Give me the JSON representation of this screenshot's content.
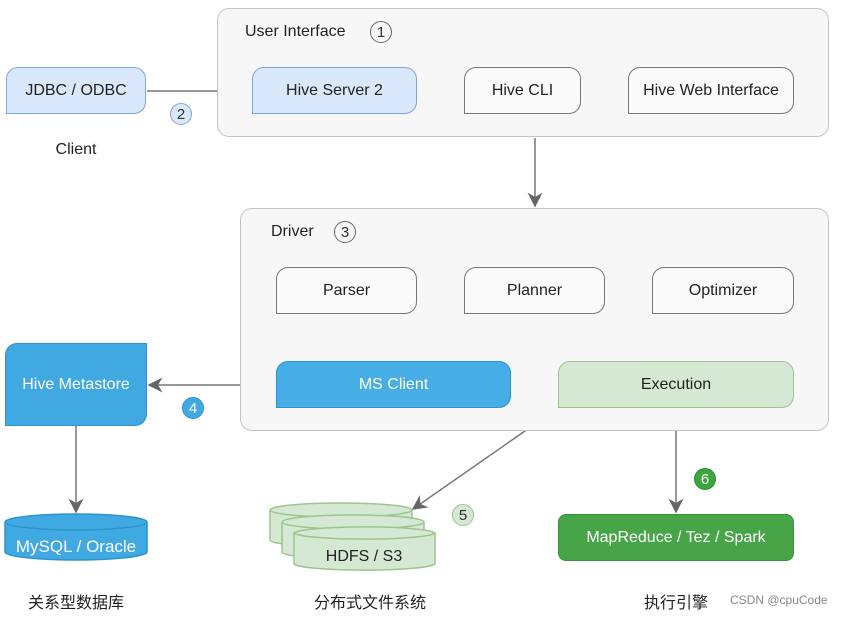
{
  "client": {
    "jdbc": "JDBC / ODBC",
    "label": "Client",
    "step": "2"
  },
  "ui": {
    "title": "User Interface",
    "step": "1",
    "hive_server": "Hive Server 2",
    "hive_cli": "Hive CLI",
    "hive_web": "Hive Web Interface"
  },
  "driver": {
    "title": "Driver",
    "step": "3",
    "parser": "Parser",
    "planner": "Planner",
    "optimizer": "Optimizer",
    "ms_client": "MS Client",
    "execution": "Execution"
  },
  "metastore": {
    "name": "Hive Metastore",
    "step": "4",
    "db": "MySQL / Oracle",
    "label": "关系型数据库"
  },
  "storage": {
    "name": "HDFS / S3",
    "step": "5",
    "label": "分布式文件系统"
  },
  "engine": {
    "name": "MapReduce / Tez / Spark",
    "step": "6",
    "label": "执行引擎"
  },
  "watermark": "CSDN @cpuCode",
  "colors": {
    "blue_light": "#dae8fc",
    "blue": "#41a9e2",
    "green_light": "#d5e8d4",
    "green": "#47a447"
  }
}
